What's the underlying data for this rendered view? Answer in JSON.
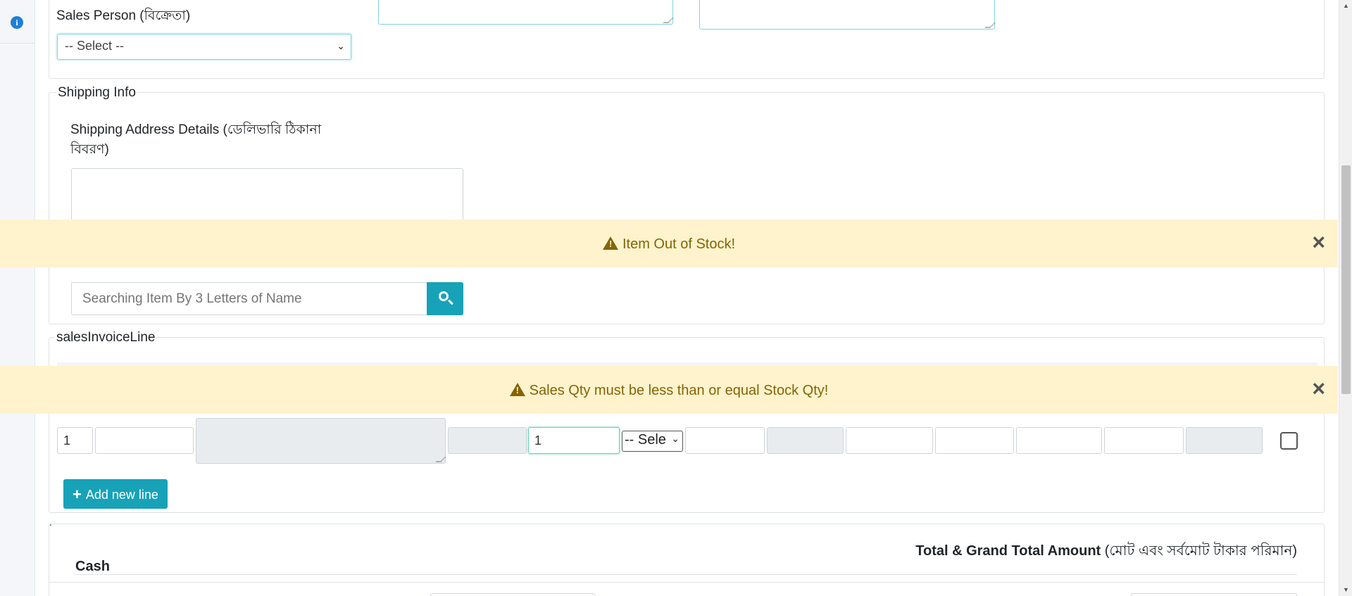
{
  "sales_person": {
    "label": "Sales Person (বিক্রেতা)",
    "select_value": "-- Select --"
  },
  "shipping_info": {
    "legend": "Shipping Info",
    "address_label_line1": "Shipping Address Details (ডেলিভারি ঠিকানা",
    "address_label_line2": "বিবরণ)"
  },
  "alerts": [
    {
      "message": "Item Out of Stock!",
      "close": "×"
    },
    {
      "message": "Sales Qty must be less than or equal Stock Qty!",
      "close": "×"
    }
  ],
  "item_search": {
    "placeholder": "Searching Item By 3 Letters of Name"
  },
  "sales_invoice_line": {
    "legend": "salesInvoiceLine",
    "row": {
      "serial": "1",
      "quantity": "1",
      "unit_select": "-- Sele"
    },
    "add_button": "Add new line"
  },
  "totals": {
    "dot": ".",
    "heading": "Total & Grand Total Amount",
    "heading_bn": "(মোট এবং সর্বমোট টাকার পরিমান)",
    "cash_label": "Cash"
  },
  "icons": {
    "info": "info-circle-icon",
    "warning": "warning-triangle-icon",
    "close": "close-icon",
    "search": "search-icon",
    "plus": "plus-icon",
    "chevron": "chevron-down-icon"
  },
  "colors": {
    "alert_bg": "#fff3cd",
    "alert_text": "#856404",
    "primary_teal": "#17a2b8",
    "focus_border": "#80d2e0"
  }
}
